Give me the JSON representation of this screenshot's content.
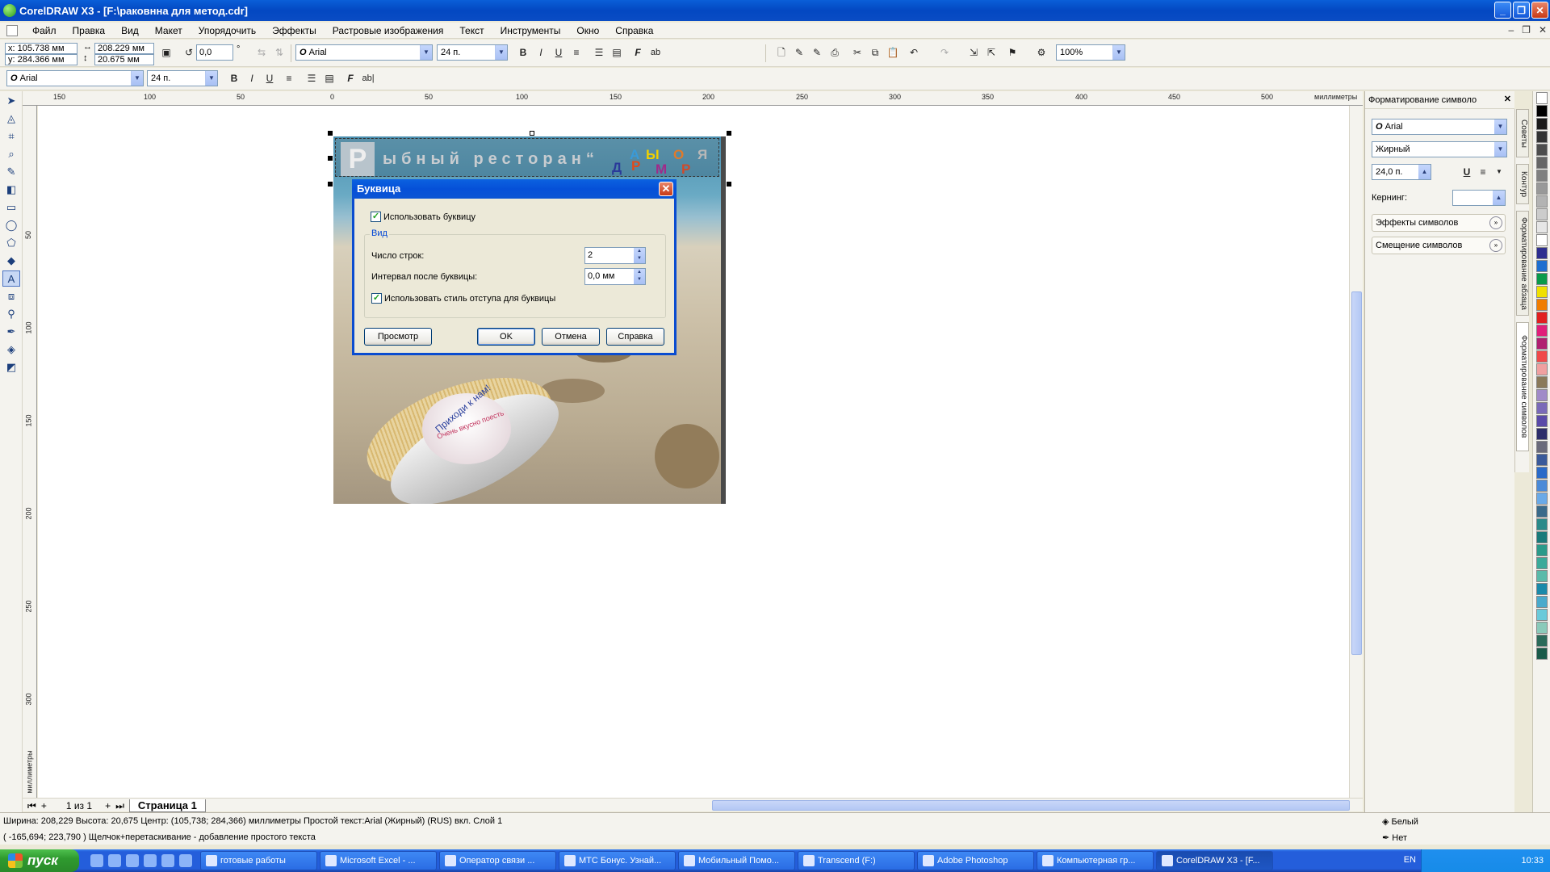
{
  "window": {
    "title": "CorelDRAW X3 - [F:\\раковнна для метод.cdr]",
    "buttons": [
      "_",
      "❐",
      "✕"
    ]
  },
  "menu": {
    "items": [
      "Файл",
      "Правка",
      "Вид",
      "Макет",
      "Упорядочить",
      "Эффекты",
      "Растровые изображения",
      "Текст",
      "Инструменты",
      "Окно",
      "Справка"
    ]
  },
  "property_bar": {
    "x": "x: 105.738 мм",
    "y": "y: 284.366 мм",
    "width": "208.229 мм",
    "height": "20.675 мм",
    "angle": "0,0",
    "angle_unit": "°",
    "font": "Arial",
    "size": "24 п.",
    "zoom": "100%"
  },
  "text_bar": {
    "font": "Arial",
    "size": "24 п.",
    "ab": "ab|"
  },
  "ruler": {
    "h_ticks": [
      "150",
      "100",
      "50",
      "0",
      "50",
      "100",
      "150",
      "200",
      "250",
      "300",
      "350",
      "400",
      "450",
      "500"
    ],
    "units": "миллиметры",
    "v_ticks": [
      "50",
      "100",
      "150",
      "200",
      "250",
      "300"
    ],
    "v_units": "миллиметры"
  },
  "artwork": {
    "drop_cap": "Р",
    "headline": "ыбный ресторан“",
    "curved_1": "Приходи к нам!",
    "curved_2": "Очень вкусно поесть"
  },
  "dialog": {
    "title": "Буквица",
    "use_dropcap": "Использовать буквицу",
    "group_label": "Вид",
    "lines_label": "Число строк:",
    "lines_value": "2",
    "interval_label": "Интервал после буквицы:",
    "interval_value": "0,0 мм",
    "indent_style": "Использовать стиль отступа для буквицы",
    "preview": "Просмотр",
    "ok": "OK",
    "cancel": "Отмена",
    "help": "Справка"
  },
  "page_nav": {
    "counter": "1 из 1",
    "page_tab": "Страница 1"
  },
  "docker": {
    "title": "Форматирование символо",
    "font": "Arial",
    "style": "Жирный",
    "size": "24,0 п.",
    "kerning_label": "Кернинг:",
    "effects": "Эффекты символов",
    "offset": "Смещение символов",
    "vtabs": [
      "Советы",
      "Контур",
      "Форматирование абзаца",
      "Форматирование символов"
    ]
  },
  "palette": [
    "#ffffff",
    "#000000",
    "#1a1a1a",
    "#333333",
    "#4d4d4d",
    "#666666",
    "#808080",
    "#999999",
    "#b3b3b3",
    "#cccccc",
    "#e6e6e6",
    "#ffffff",
    "#2e2e8f",
    "#1f6fd0",
    "#0a9a4a",
    "#f0e000",
    "#f07d00",
    "#e02020",
    "#e0207a",
    "#b02070",
    "#f04a4a",
    "#f0a0a0",
    "#8a7a5a",
    "#a08ac8",
    "#7a6ab8",
    "#5a4aa8",
    "#2e2e6a",
    "#6a6a7a",
    "#3a5a9a",
    "#2a6ac8",
    "#4a8ad8",
    "#6aaae8",
    "#3a6a8a",
    "#2a8a8a",
    "#1a7a7a",
    "#2a9a8a",
    "#3aaa9a",
    "#5abaaa",
    "#1a8aaa",
    "#4aaacc",
    "#6acada",
    "#8acaba",
    "#2a6a5a",
    "#1a5a4a"
  ],
  "status": {
    "line1": "Ширина: 208,229  Высота: 20,675  Центр: (105,738; 284,366)  миллиметры          Простой текст:Arial (Жирный) (RUS) вкл. Слой 1",
    "line2": "( -165,694; 223,790 )   Щелчок+перетаскивание - добавление простого текста",
    "fill": "Белый",
    "outline": "Нет"
  },
  "taskbar": {
    "start": "пуск",
    "tasks": [
      "готовые работы",
      "Microsoft Excel - ...",
      "Оператор связи ...",
      "МТС Бонус. Узнай...",
      "Мобильный Помо...",
      "Transcend (F:)",
      "Adobe Photoshop",
      "Компьютерная гр...",
      "CorelDRAW X3 - [F..."
    ],
    "lang": "EN",
    "time": "10:33"
  }
}
